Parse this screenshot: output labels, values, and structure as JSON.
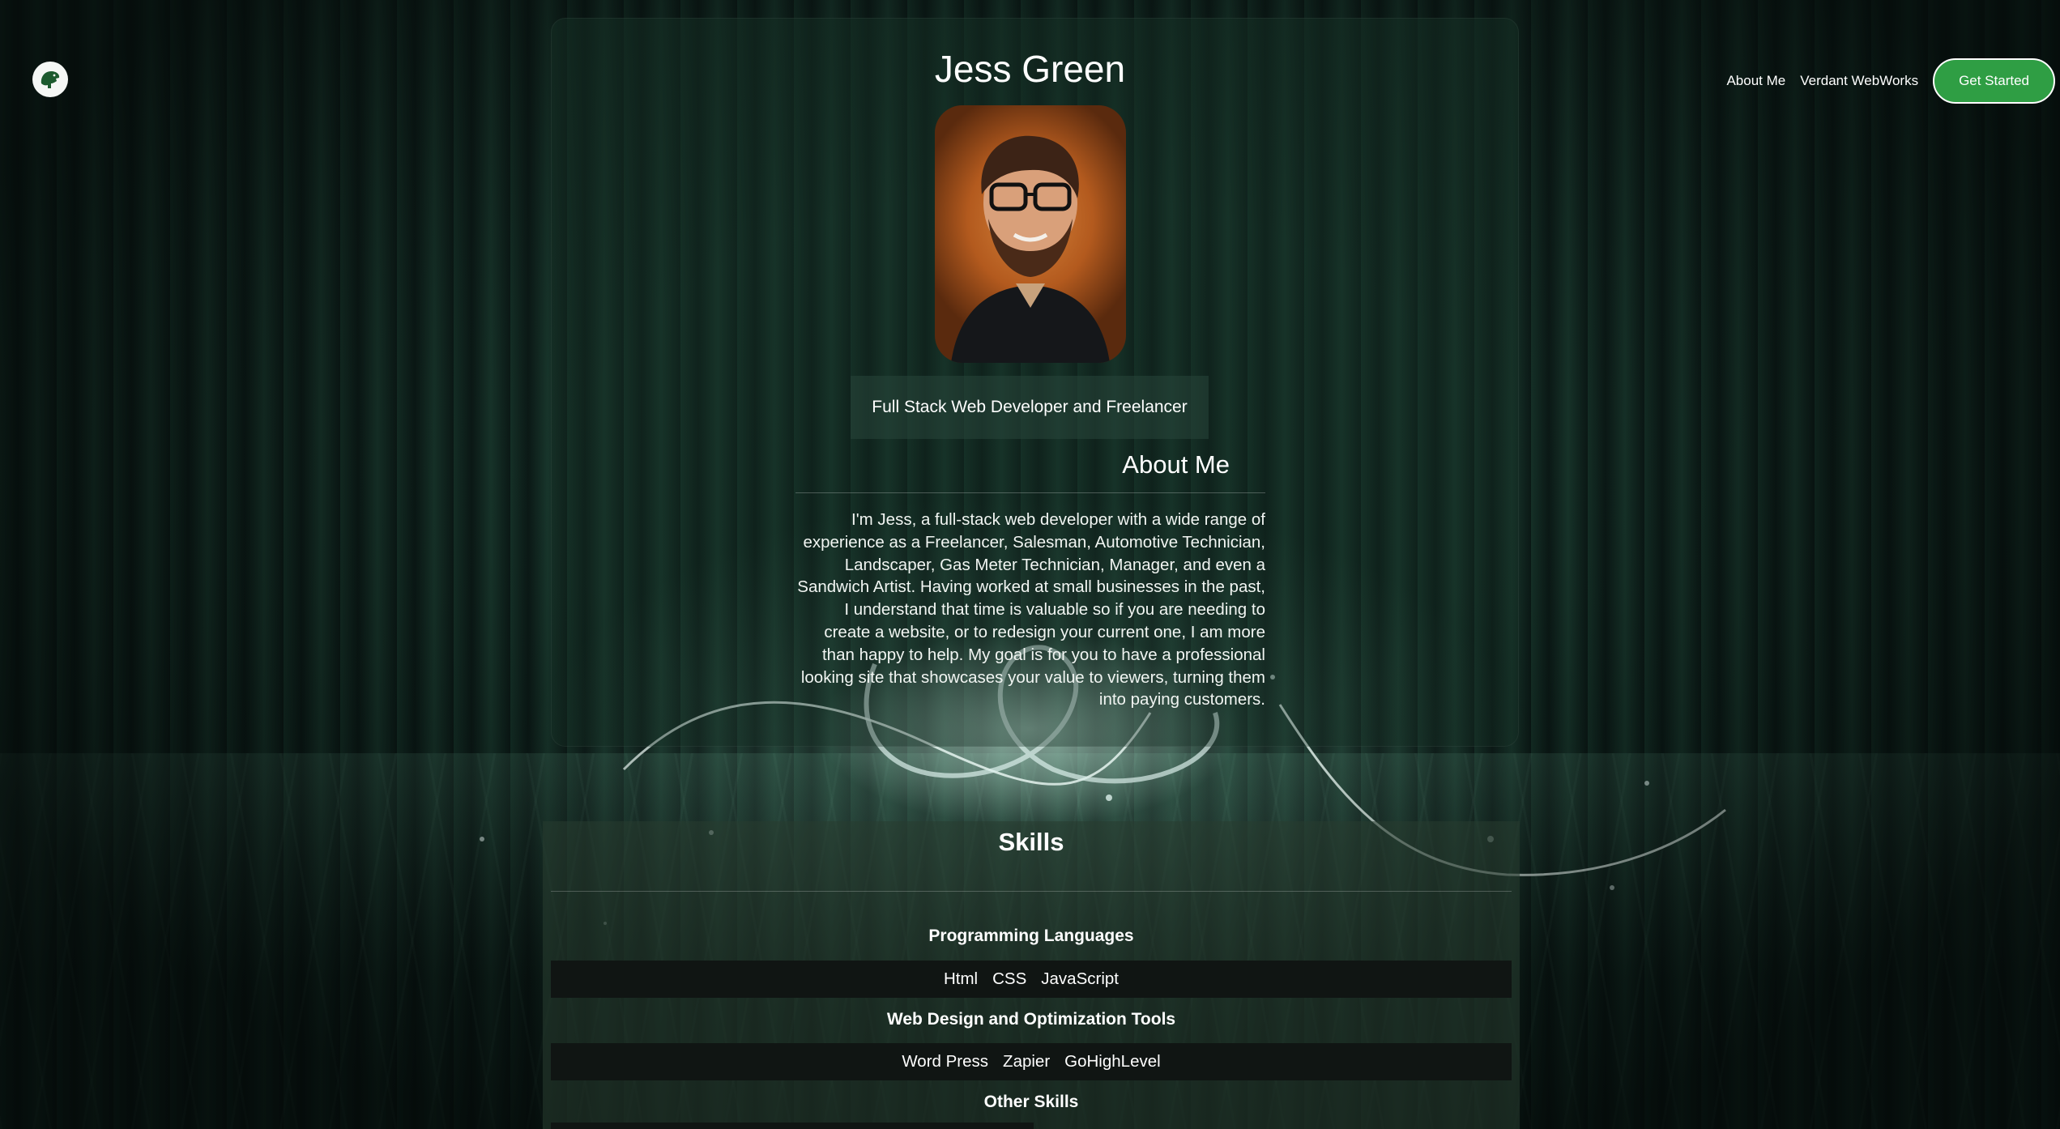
{
  "header": {
    "logo_icon": "dinosaur-logo-icon",
    "nav": [
      {
        "label": "About Me"
      },
      {
        "label": "Verdant WebWorks"
      }
    ],
    "cta_label": "Get Started"
  },
  "profile": {
    "name": "Jess Green",
    "photo_alt": "portrait-photo",
    "tagline": "Full Stack Web Developer and Freelancer"
  },
  "about": {
    "title": "About Me",
    "text": "I'm Jess, a full-stack web developer with a wide range of experience as a Freelancer, Salesman, Automotive Technician, Landscaper, Gas Meter Technician, Manager, and even a Sandwich Artist. Having worked at small businesses in the past, I understand that time is valuable so if you are needing to create a website, or to redesign your current one, I am more than happy to help. My goal is for you to have a professional looking site that showcases your value to viewers, turning them into paying customers."
  },
  "skills": {
    "title": "Skills",
    "categories": [
      {
        "title": "Programming Languages",
        "items": [
          "Html",
          "CSS",
          "JavaScript"
        ]
      },
      {
        "title": "Web Design and Optimization Tools",
        "items": [
          "Word Press",
          "Zapier",
          "GoHighLevel"
        ]
      },
      {
        "title": "Other Skills",
        "items": []
      }
    ]
  },
  "colors": {
    "accent": "#2f9e44",
    "background": "#0a1412",
    "skill_row": "#101513"
  }
}
